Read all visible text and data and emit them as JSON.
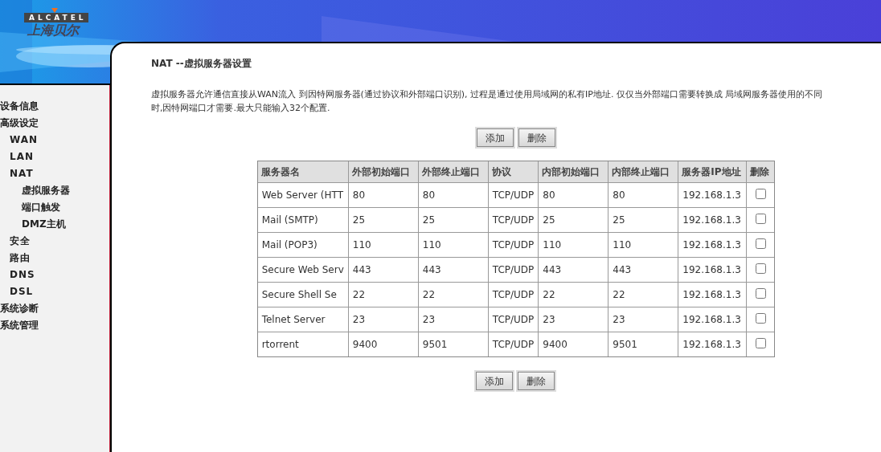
{
  "header": {
    "logo_brand": "ALCATEL",
    "logo_local": "上海贝尔"
  },
  "sidebar": {
    "items": [
      {
        "label": "设备信息"
      },
      {
        "label": "高级设定",
        "children": [
          {
            "label": "WAN"
          },
          {
            "label": "LAN"
          },
          {
            "label": "NAT",
            "children": [
              {
                "label": "虚拟服务器"
              },
              {
                "label": "端口触发"
              },
              {
                "label": "DMZ主机"
              }
            ]
          },
          {
            "label": "安全"
          },
          {
            "label": "路由"
          },
          {
            "label": "DNS"
          },
          {
            "label": "DSL"
          }
        ]
      },
      {
        "label": "系统诊断"
      },
      {
        "label": "系统管理"
      }
    ]
  },
  "page": {
    "title": "NAT --虚拟服务器设置",
    "description_lines": [
      "虚拟服务器允许通信直接从WAN流入 到因特网服务器(通过协议和外部端口识别), 过程是通过使用局域网的私有IP地址. 仅仅当外部端口需要转换成 局域网服务器使用的不同",
      "时,因特网端口才需要.最大只能输入32个配置."
    ],
    "top_buttons": [
      "添加",
      "删除"
    ],
    "bottom_buttons": [
      "添加",
      "删除"
    ]
  },
  "table": {
    "columns": [
      "服务器名",
      "外部初始端口",
      "外部终止端口",
      "协议",
      "内部初始端口",
      "内部终止端口",
      "服务器IP地址",
      "删除"
    ],
    "rows": [
      {
        "cells": [
          "Web Server (HTT",
          "80",
          "80",
          "TCP/UDP",
          "80",
          "80",
          "192.168.1.3"
        ],
        "checked": false
      },
      {
        "cells": [
          "Mail (SMTP)",
          "25",
          "25",
          "TCP/UDP",
          "25",
          "25",
          "192.168.1.3"
        ],
        "checked": false
      },
      {
        "cells": [
          "Mail (POP3)",
          "110",
          "110",
          "TCP/UDP",
          "110",
          "110",
          "192.168.1.3"
        ],
        "checked": false
      },
      {
        "cells": [
          "Secure Web Serv",
          "443",
          "443",
          "TCP/UDP",
          "443",
          "443",
          "192.168.1.3"
        ],
        "checked": false
      },
      {
        "cells": [
          "Secure Shell Se",
          "22",
          "22",
          "TCP/UDP",
          "22",
          "22",
          "192.168.1.3"
        ],
        "checked": false
      },
      {
        "cells": [
          "Telnet Server",
          "23",
          "23",
          "TCP/UDP",
          "23",
          "23",
          "192.168.1.3"
        ],
        "checked": false
      },
      {
        "cells": [
          "rtorrent",
          "9400",
          "9501",
          "TCP/UDP",
          "9400",
          "9501",
          "192.168.1.3"
        ],
        "checked": false
      }
    ]
  }
}
